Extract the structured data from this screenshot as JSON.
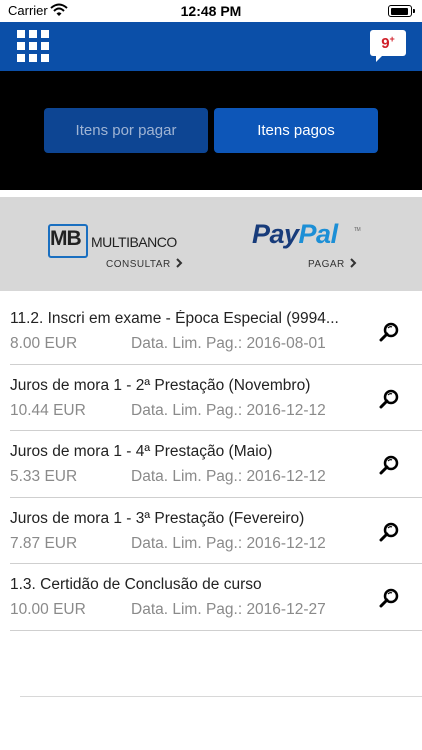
{
  "status_bar": {
    "carrier": "Carrier",
    "time": "12:48 PM",
    "icons": [
      "wifi-icon",
      "battery-icon"
    ]
  },
  "nav": {
    "menu_icon": "grid-menu-icon",
    "notifications": {
      "count": "9",
      "plus": "+",
      "icon": "speech-bubble-icon"
    }
  },
  "tabs": [
    {
      "label": "Itens por pagar",
      "selected": true
    },
    {
      "label": "Itens pagos",
      "selected": false
    }
  ],
  "payment": {
    "multibanco": {
      "logo_letters": "MB",
      "logo_text": "MULTIBANCO",
      "action": "CONSULTAR",
      "action_icon": "chevron-right-icon"
    },
    "paypal": {
      "logo_dark": "Pay",
      "logo_light": "Pal",
      "tm": "TM",
      "action": "PAGAR",
      "action_icon": "chevron-right-icon"
    }
  },
  "items": [
    {
      "title": "11.2. Inscri em exame - Época Especial (9994...",
      "amount": "8.00 EUR",
      "date": "Data. Lim. Pag.: 2016-08-01"
    },
    {
      "title": "Juros de mora 1 - 2ª Prestação (Novembro)",
      "amount": "10.44 EUR",
      "date": "Data. Lim. Pag.: 2016-12-12"
    },
    {
      "title": "Juros de mora 1 - 4ª Prestação (Maio)",
      "amount": "5.33 EUR",
      "date": "Data. Lim. Pag.: 2016-12-12"
    },
    {
      "title": "Juros de mora 1 - 3ª Prestação (Fevereiro)",
      "amount": "7.87 EUR",
      "date": "Data. Lim. Pag.: 2016-12-12"
    },
    {
      "title": "1.3. Certidão de Conclusão de curso",
      "amount": "10.00 EUR",
      "date": "Data. Lim. Pag.: 2016-12-27"
    }
  ],
  "colors": {
    "nav_blue": "#0b4fa8",
    "tab_selected": "#0d4593",
    "tab_unselected": "#0d56b8",
    "multibanco_blue": "#1a6fc0",
    "paypal_dark": "#173b7a",
    "paypal_light": "#1c8fd6"
  }
}
